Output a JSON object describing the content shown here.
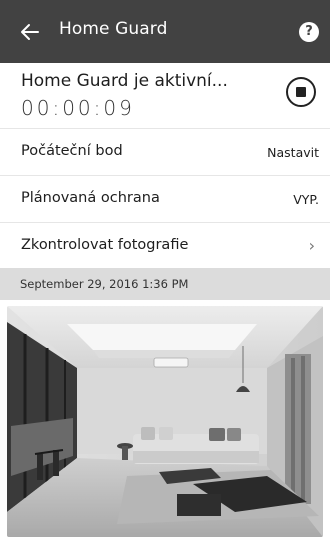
{
  "appbar": {
    "title": "Home Guard",
    "help_label": "?"
  },
  "status": {
    "text": "Home Guard je aktivní...",
    "timer": "00:00:09"
  },
  "rows": [
    {
      "label": "Počáteční bod",
      "value": "Nastavit"
    },
    {
      "label": "Plánovaná ochrana",
      "value": "VYP."
    },
    {
      "label": "Zkontrolovat fotografie",
      "chevron": "›"
    }
  ],
  "date": "September 29, 2016 1:36 PM",
  "colors": {
    "appbar": "#424242",
    "datebar": "#dcdcdc"
  },
  "icons": [
    "back-arrow-icon",
    "help-icon",
    "stop-icon",
    "chevron-right-icon"
  ]
}
